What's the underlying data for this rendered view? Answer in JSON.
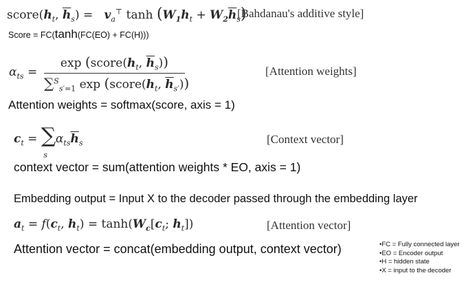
{
  "score": {
    "equation": "score(hₜ, h̄ₛ) = vₐᵀ tanh(W₁hₜ + W₂h̄ₛ)",
    "tag": "[Bahdanau's additive style]",
    "note_prefix": "Score = FC(",
    "note_tanh": "tanh",
    "note_suffix": "(FC(EO) + FC(H)))"
  },
  "attention_weights": {
    "lhs": "αₜₛ =",
    "numerator": "exp (score(hₜ, h̄ₛ))",
    "denominator": "∑ exp (score(hₜ, h̄ₛ′))",
    "tag": "[Attention weights]",
    "note": "Attention weights = softmax(score, axis = 1)"
  },
  "context_vector": {
    "equation": "cₜ = ∑ αₜₛ h̄ₛ",
    "tag": "[Context vector]",
    "note": "context vector = sum(attention weights * EO, axis = 1)"
  },
  "embedding_note": "Embedding output = Input X to the decoder passed through the embedding layer",
  "attention_vector": {
    "equation": "aₜ = f(cₜ, hₜ) = tanh(Wᴄ[cₜ; hₜ])",
    "tag": "[Attention vector]",
    "note": "Attention vector = concat(embedding output, context vector)"
  },
  "legend": [
    "•FC = Fully connected layer",
    "•EO = Encoder output",
    "•H = hidden state",
    "•X = input to the decoder"
  ]
}
